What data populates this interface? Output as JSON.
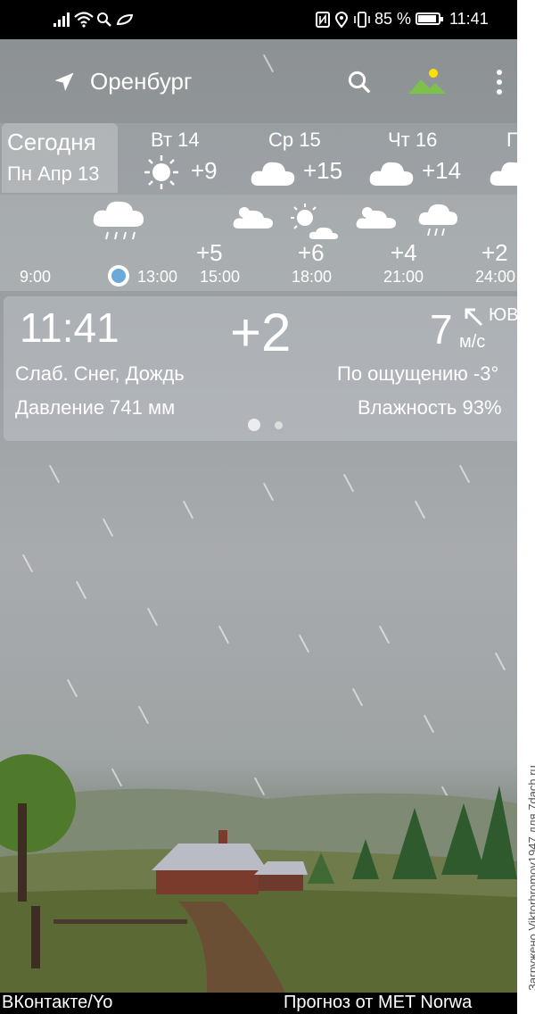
{
  "status_bar": {
    "battery": "85 %",
    "time": "11:41"
  },
  "toolbar": {
    "city": "Оренбург",
    "icons": [
      "location-arrow-icon",
      "search-icon",
      "landscape-icon",
      "more-vert-icon"
    ]
  },
  "today": {
    "label": "Сегодня",
    "date": "Пн Апр 13"
  },
  "daily": [
    {
      "day": "Вт 14",
      "temp": "+9",
      "icon": "sun-icon"
    },
    {
      "day": "Ср 15",
      "temp": "+15",
      "icon": "cloud-icon"
    },
    {
      "day": "Чт 16",
      "temp": "+14",
      "icon": "cloud-icon"
    },
    {
      "day": "П",
      "temp": "",
      "icon": "cloud-icon"
    }
  ],
  "hourly": [
    {
      "time": "9:00",
      "temp": "",
      "icon": "rain-cloud-icon"
    },
    {
      "time": "13:00",
      "temp": "",
      "icon": "current-marker-icon"
    },
    {
      "time": "15:00",
      "temp": "+5",
      "icon": "partly-cloudy-icon"
    },
    {
      "time": "18:00",
      "temp": "+6",
      "icon": "sun-cloud-icon"
    },
    {
      "time": "21:00",
      "temp": "+4",
      "icon": "partly-cloudy-icon"
    },
    {
      "time": "24:00",
      "temp": "+2",
      "icon": "rain-cloud-icon"
    }
  ],
  "current": {
    "time": "11:41",
    "temp": "+2",
    "wind_speed": "7",
    "wind_unit": "м/с",
    "wind_dir": "ЮВ",
    "condition": "Слаб. Снег, Дождь",
    "feels_like": "По ощущению -3°",
    "pressure": "Давление 741 мм",
    "humidity": "Влажность 93%"
  },
  "bottom": {
    "left": "ВКонтакте/Yo",
    "right": "Прогноз от MET Norwa"
  },
  "watermark": "Загружено Viktorhromov1947 для 7dach.ru"
}
